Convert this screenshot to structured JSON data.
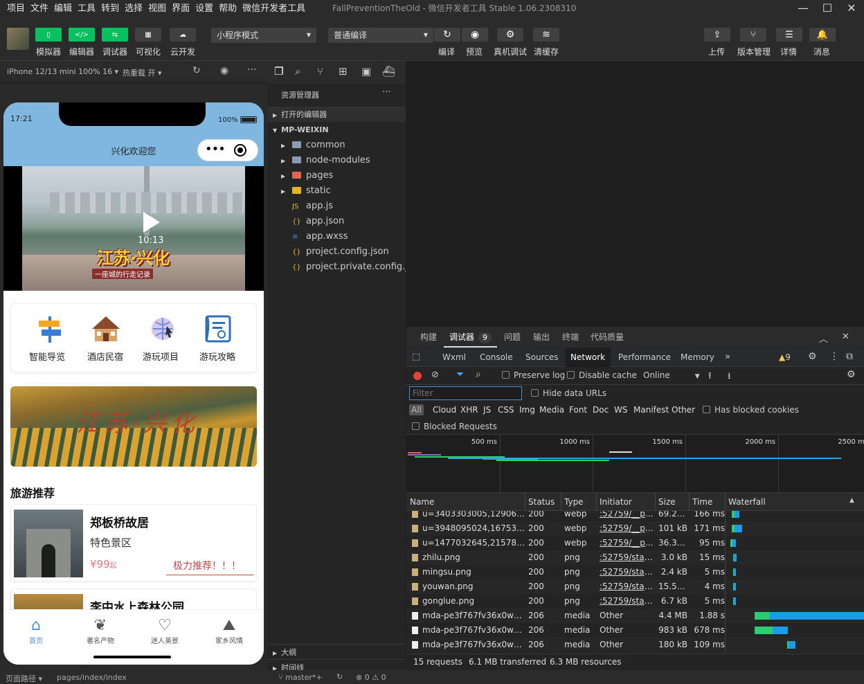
{
  "menu": {
    "items": [
      "项目",
      "文件",
      "编辑",
      "工具",
      "转到",
      "选择",
      "视图",
      "界面",
      "设置",
      "帮助",
      "微信开发者工具"
    ],
    "window_title": "FallPreventionTheOld - 微信开发者工具 Stable 1.06.2308310"
  },
  "toolbar": {
    "left": [
      {
        "label": "模拟器",
        "glyph": "▯"
      },
      {
        "label": "编辑器",
        "glyph": "</>"
      },
      {
        "label": "调试器",
        "glyph": "⇆"
      },
      {
        "label": "可视化",
        "glyph": "▦"
      },
      {
        "label": "云开发",
        "glyph": "☁"
      }
    ],
    "mode": "小程序模式",
    "compile": "普通编译",
    "mid": [
      {
        "label": "编译",
        "glyph": "↻"
      },
      {
        "label": "预览",
        "glyph": "◉"
      },
      {
        "label": "真机调试",
        "glyph": "⚙"
      },
      {
        "label": "清缓存",
        "glyph": "≋"
      }
    ],
    "right": [
      {
        "label": "上传",
        "glyph": "⇪"
      },
      {
        "label": "版本管理",
        "glyph": "⑂"
      },
      {
        "label": "详情",
        "glyph": "☰"
      },
      {
        "label": "消息",
        "glyph": "🔔"
      }
    ]
  },
  "simulator": {
    "device": "iPhone 12/13 mini 100% 16 ▾",
    "hotreload": "热重载 开 ▾"
  },
  "phone": {
    "time": "17:21",
    "battery": "100%",
    "title": "兴化欢迎您",
    "video": {
      "duration": "10:13",
      "caption_main": "江苏·兴化",
      "caption_sub": "一座城的行走记录"
    },
    "nav": [
      {
        "label": "智能导览"
      },
      {
        "label": "酒店民宿"
      },
      {
        "label": "游玩项目"
      },
      {
        "label": "游玩攻略"
      }
    ],
    "banner_text": "江苏·兴化",
    "section_title": "旅游推荐",
    "rec": [
      {
        "name": "郑板桥故居",
        "tag": "特色景区",
        "price": "¥99",
        "price_suffix": "起",
        "note": "极力推荐！！！"
      },
      {
        "name": "李中水上森林公园"
      }
    ],
    "tabs": [
      {
        "label": "首页",
        "active": true
      },
      {
        "label": "著名产物"
      },
      {
        "label": "迷人美景"
      },
      {
        "label": "家乡风情"
      }
    ]
  },
  "explorer": {
    "title": "资源管理器",
    "open_editors": "打开的编辑器",
    "project": "MP-WEIXIN",
    "items": [
      {
        "name": "common",
        "type": "folder"
      },
      {
        "name": "node-modules",
        "type": "folder"
      },
      {
        "name": "pages",
        "type": "folder-red"
      },
      {
        "name": "static",
        "type": "folder-yellow"
      },
      {
        "name": "app.js",
        "type": "js"
      },
      {
        "name": "app.json",
        "type": "json"
      },
      {
        "name": "app.wxss",
        "type": "css"
      },
      {
        "name": "project.config.json",
        "type": "json"
      },
      {
        "name": "project.private.config.js...",
        "type": "json"
      }
    ],
    "outline": "大纲",
    "timeline": "时间线"
  },
  "devtools": {
    "tabs": [
      "构建",
      "调试器",
      "问题",
      "输出",
      "终端",
      "代码质量"
    ],
    "badge": "9",
    "panel_tabs": [
      "Wxml",
      "Console",
      "Sources",
      "Network",
      "Performance",
      "Memory"
    ],
    "warn_count": "9",
    "preserve_log": "Preserve log",
    "disable_cache": "Disable cache",
    "throttle": "Online",
    "filter_placeholder": "Filter",
    "hide_data_urls": "Hide data URLs",
    "types": [
      "All",
      "Cloud",
      "XHR",
      "JS",
      "CSS",
      "Img",
      "Media",
      "Font",
      "Doc",
      "WS",
      "Manifest",
      "Other"
    ],
    "has_blocked": "Has blocked cookies",
    "blocked_requests": "Blocked Requests",
    "timeline_ticks": [
      "500 ms",
      "1000 ms",
      "1500 ms",
      "2000 ms",
      "2500 ms"
    ],
    "columns": [
      "Name",
      "Status",
      "Type",
      "Initiator",
      "Size",
      "Time",
      "Waterfall"
    ],
    "rows": [
      {
        "name": "u=3403303005,1290615?...",
        "status": "200",
        "type": "webp",
        "initiator": ":52759/__pa...",
        "size": "69.2 kB",
        "time": "166 ms"
      },
      {
        "name": "u=3948095024,16753276...",
        "status": "200",
        "type": "webp",
        "initiator": ":52759/__pa...",
        "size": "101 kB",
        "time": "171 ms"
      },
      {
        "name": "u=1477032645,21578361...",
        "status": "200",
        "type": "webp",
        "initiator": ":52759/__pa...",
        "size": "36.3 kB",
        "time": "95 ms"
      },
      {
        "name": "zhilu.png",
        "status": "200",
        "type": "png",
        "initiator": ":52759/stati...",
        "size": "3.0 kB",
        "time": "15 ms"
      },
      {
        "name": "mingsu.png",
        "status": "200",
        "type": "png",
        "initiator": ":52759/stati...",
        "size": "2.4 kB",
        "time": "5 ms"
      },
      {
        "name": "youwan.png",
        "status": "200",
        "type": "png",
        "initiator": ":52759/stati...",
        "size": "15.5 kB",
        "time": "4 ms"
      },
      {
        "name": "gonglue.png",
        "status": "200",
        "type": "png",
        "initiator": ":52759/stati...",
        "size": "6.7 kB",
        "time": "5 ms"
      },
      {
        "name": "mda-pe3f767fv36x0wmc....",
        "status": "206",
        "type": "media",
        "initiator": "Other",
        "size": "4.4 MB",
        "time": "1.88 s"
      },
      {
        "name": "mda-pe3f767fv36x0wmc....",
        "status": "206",
        "type": "media",
        "initiator": "Other",
        "size": "983 kB",
        "time": "678 ms"
      },
      {
        "name": "mda-pe3f767fv36x0wmc....",
        "status": "206",
        "type": "media",
        "initiator": "Other",
        "size": "180 kB",
        "time": "109 ms"
      }
    ],
    "summary": {
      "requests": "15 requests",
      "transferred": "6.1 MB transferred",
      "resources": "6.3 MB resources"
    }
  },
  "statusbar": {
    "path_label": "页面路径 ▾",
    "path": "pages/index/index",
    "branch": "master*+",
    "errors": "⊗ 0 ⚠ 0"
  }
}
